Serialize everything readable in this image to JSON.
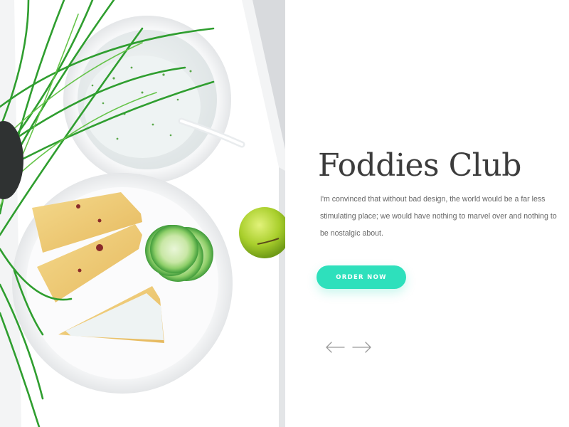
{
  "hero": {
    "title": "Foddies Club",
    "description": "I'm convinced that without bad design, the world would be a far less stimulating place; we would have nothing to marvel over and nothing to be nostalgic about.",
    "cta_label": "ORDER NOW"
  },
  "navigation": {
    "prev_icon": "arrow-left-icon",
    "next_icon": "arrow-right-icon"
  },
  "colors": {
    "accent": "#2ee0bc",
    "title": "#3c3c3c",
    "body_text": "#666666",
    "arrow": "#9a9a9a"
  }
}
